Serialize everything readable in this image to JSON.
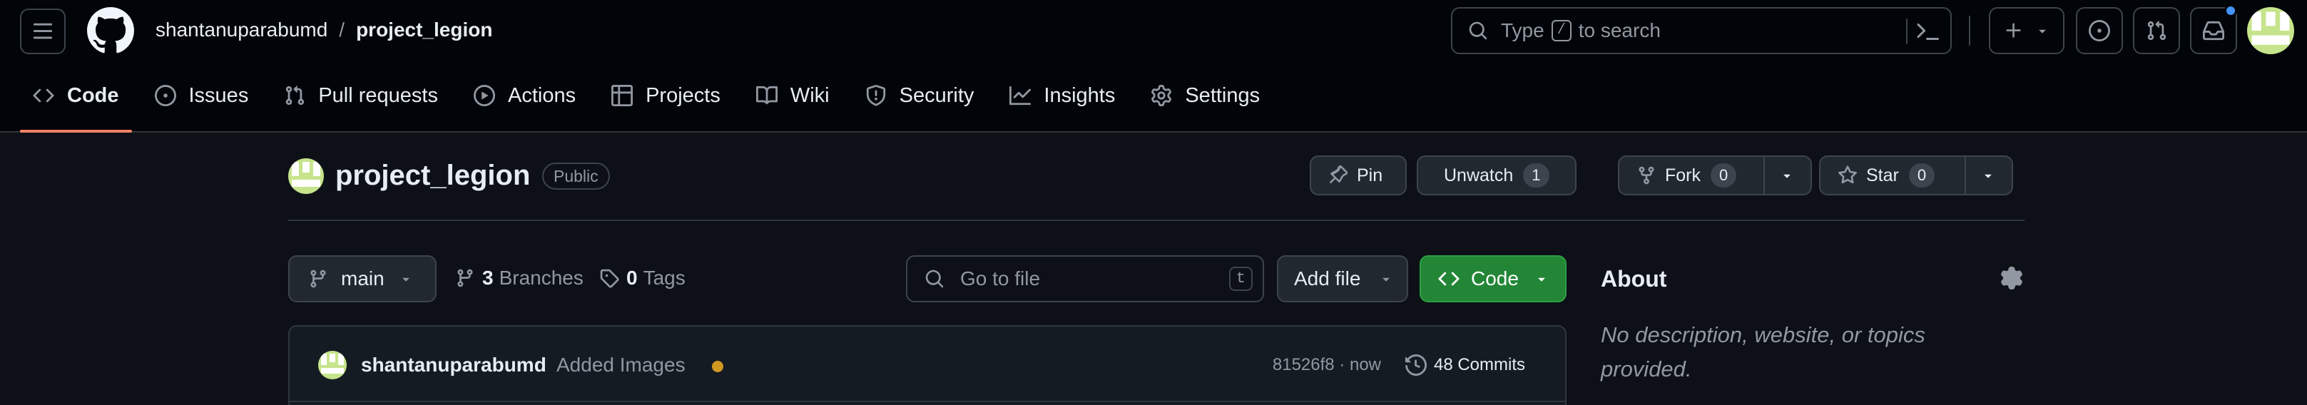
{
  "header": {
    "owner": "shantanuparabumd",
    "separator": "/",
    "repo": "project_legion",
    "search": {
      "before": "Type",
      "key": "/",
      "after": "to search"
    }
  },
  "repo_nav": {
    "tabs": [
      {
        "label": "Code"
      },
      {
        "label": "Issues"
      },
      {
        "label": "Pull requests"
      },
      {
        "label": "Actions"
      },
      {
        "label": "Projects"
      },
      {
        "label": "Wiki"
      },
      {
        "label": "Security"
      },
      {
        "label": "Insights"
      },
      {
        "label": "Settings"
      }
    ],
    "active_tab": "Code"
  },
  "repo_header": {
    "name": "project_legion",
    "visibility": "Public",
    "pin_label": "Pin",
    "watch_label": "Unwatch",
    "watch_count": "1",
    "fork_label": "Fork",
    "fork_count": "0",
    "star_label": "Star",
    "star_count": "0"
  },
  "file_nav": {
    "branch": "main",
    "branches_count": "3",
    "branches_label": "Branches",
    "tags_count": "0",
    "tags_label": "Tags",
    "go_to_file_placeholder": "Go to file",
    "go_to_file_key": "t",
    "add_file_label": "Add file",
    "code_label": "Code"
  },
  "latest_commit": {
    "author": "shantanuparabumd",
    "message": "Added Images",
    "hash_time": "81526f8 · now",
    "commits_label": "48 Commits",
    "status_color": "#d29922"
  },
  "about": {
    "title": "About",
    "description": "No description, website, or topics provided."
  },
  "colors": {
    "background": "#0d1117",
    "header_bg": "#010409",
    "accent_tab": "#f78166",
    "code_button": "#238636",
    "notification_dot": "#4493f8"
  }
}
